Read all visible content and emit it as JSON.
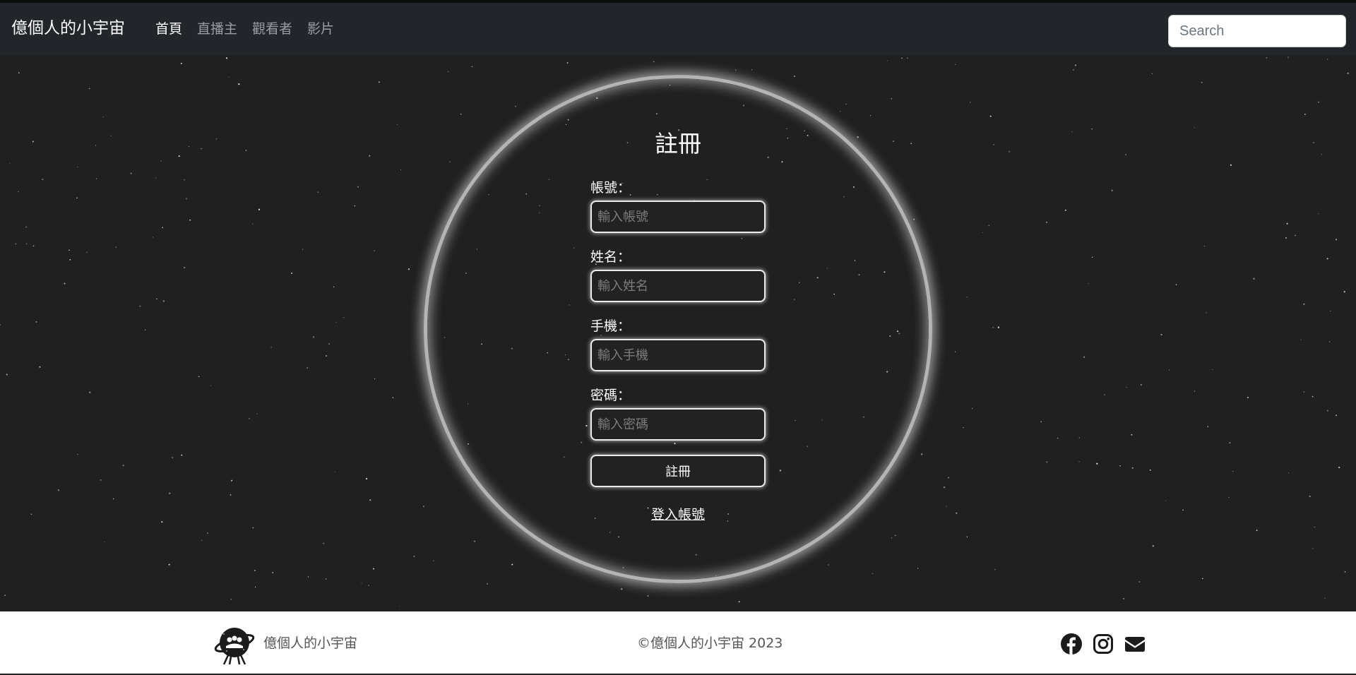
{
  "navbar": {
    "brand": "億個人的小宇宙",
    "links": [
      {
        "label": "首頁",
        "active": true
      },
      {
        "label": "直播主",
        "active": false
      },
      {
        "label": "觀看者",
        "active": false
      },
      {
        "label": "影片",
        "active": false
      }
    ],
    "search_placeholder": "Search"
  },
  "form": {
    "title": "註冊",
    "fields": [
      {
        "label": "帳號：",
        "placeholder": "輸入帳號"
      },
      {
        "label": "姓名：",
        "placeholder": "輸入姓名"
      },
      {
        "label": "手機：",
        "placeholder": "輸入手機"
      },
      {
        "label": "密碼：",
        "placeholder": "輸入密碼"
      }
    ],
    "submit_label": "註冊",
    "login_link": "登入帳號"
  },
  "footer": {
    "brand": "億個人的小宇宙",
    "copyright": "©億個人的小宇宙 2023",
    "social_icons": [
      "facebook-icon",
      "instagram-icon",
      "envelope-icon"
    ]
  },
  "colors": {
    "background": "#202020",
    "navbar": "#22252a",
    "ring": "#b4b4b4",
    "footer": "#ffffff"
  }
}
